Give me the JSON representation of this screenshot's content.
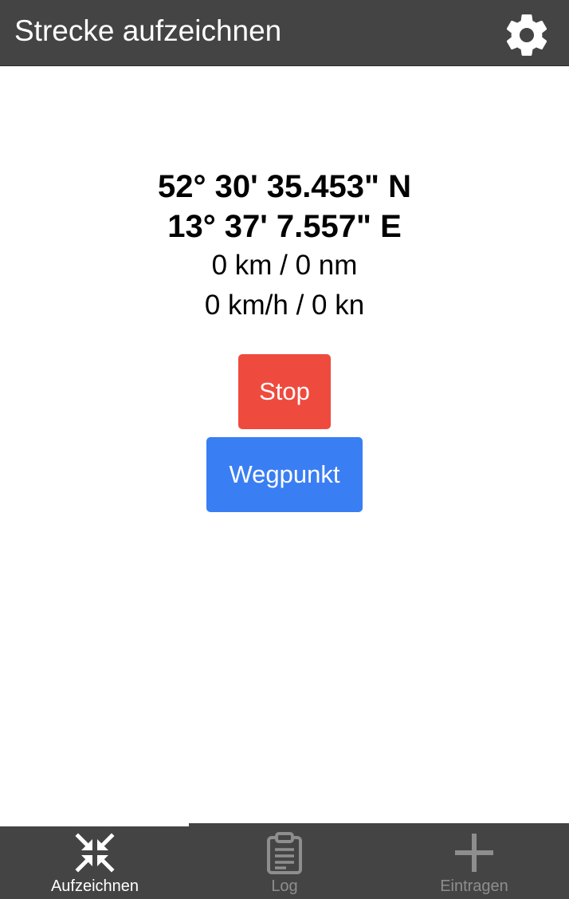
{
  "header": {
    "title": "Strecke aufzeichnen",
    "settings_icon": "gear-icon"
  },
  "position": {
    "latitude": "52° 30' 35.453\" N",
    "longitude": "13° 37' 7.557\" E"
  },
  "stats": {
    "distance": "0 km / 0 nm",
    "speed": "0 km/h / 0 kn"
  },
  "actions": {
    "stop_label": "Stop",
    "stop_color": "#ef4a3e",
    "waypoint_label": "Wegpunkt",
    "waypoint_color": "#3a7ef3"
  },
  "tabs": [
    {
      "label": "Aufzeichnen",
      "icon": "compress-arrows-icon",
      "active": true
    },
    {
      "label": "Log",
      "icon": "clipboard-icon",
      "active": false
    },
    {
      "label": "Eintragen",
      "icon": "plus-icon",
      "active": false
    }
  ],
  "colors": {
    "bar_background": "#444444",
    "active_tab": "#ffffff",
    "inactive_tab": "#8e8e8e"
  }
}
